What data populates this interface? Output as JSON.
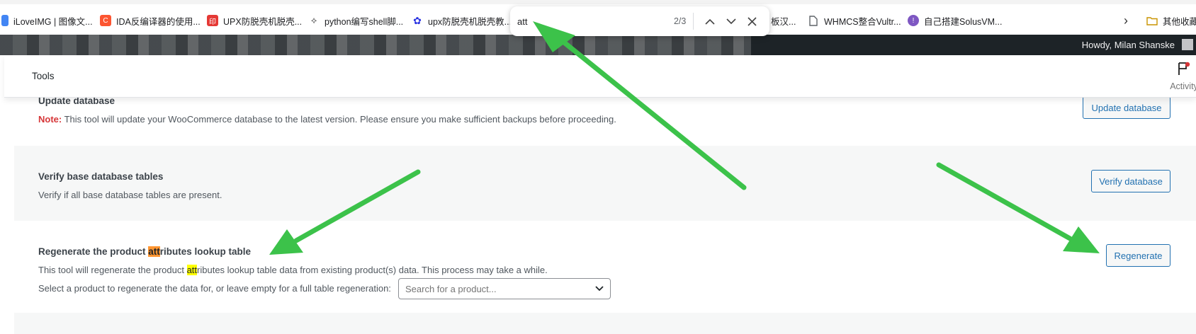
{
  "bookmarks": [
    {
      "label": "iLoveIMG | 图像文...",
      "icon": "ilovemg-icon",
      "color": "#4285f4"
    },
    {
      "label": "IDA反编译器的使用...",
      "icon": "csdn-c-icon",
      "color": "#fc5531"
    },
    {
      "label": "UPX防脱壳机脱壳...",
      "icon": "red-seal-icon",
      "color": "#e53935"
    },
    {
      "label": "python编写shell脚...",
      "icon": "zhihu-icon",
      "color": "#444444"
    },
    {
      "label": "upx防脱壳机脱壳教...",
      "icon": "baidu-paw-icon",
      "color": "#2932e1"
    },
    {
      "label": "板汉...",
      "icon": "",
      "color": ""
    },
    {
      "label": "WHMCS整合Vultr...",
      "icon": "document-icon",
      "color": "#5f6368"
    },
    {
      "label": "自己搭建SolusVM...",
      "icon": "purple-circle-icon",
      "color": "#7e57c2"
    },
    {
      "label": "其他收藏",
      "icon": "folder-icon",
      "color": "#f2b600"
    }
  ],
  "findbar": {
    "query": "att",
    "count": "2/3"
  },
  "adminbar": {
    "howdy": "Howdy, Milan Shanske"
  },
  "header": {
    "title": "Tools",
    "activity_label": "Activity"
  },
  "tools": {
    "update": {
      "title": "Update database",
      "note_label": "Note:",
      "desc": " This tool will update your WooCommerce database to the latest version. Please ensure you make sufficient backups before proceeding.",
      "button": "Update database"
    },
    "verify": {
      "title": "Verify base database tables",
      "desc": "Verify if all base database tables are present.",
      "button": "Verify database"
    },
    "regen": {
      "title_pre": "Regenerate the product ",
      "title_match": "att",
      "title_post": "ributes lookup table",
      "desc_pre": "This tool will regenerate the product ",
      "desc_match": "att",
      "desc_post": "ributes lookup table data from existing product(s) data. This process may take a while.",
      "select_label": "Select a product to regenerate the data for, or leave empty for a full table regeneration:",
      "select_placeholder": "Search for a product...",
      "button": "Regenerate"
    }
  },
  "colors": {
    "accent": "#2271b1",
    "note": "#d63638",
    "highlight": "#ffff00",
    "highlight_current": "#ff9632",
    "arrow": "#3cc24a"
  }
}
